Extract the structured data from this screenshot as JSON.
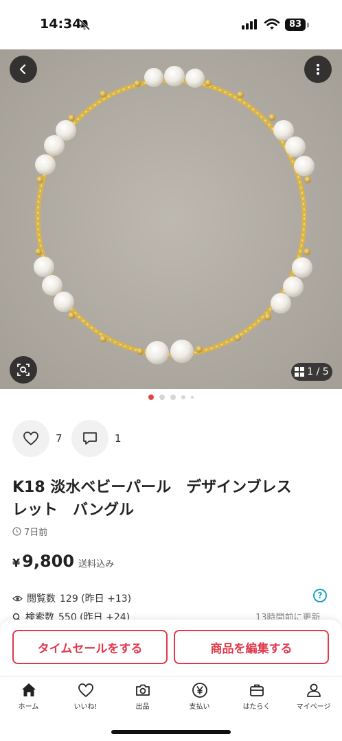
{
  "status_bar": {
    "time": "14:34",
    "battery": "83"
  },
  "gallery": {
    "counter": "1 / 5",
    "total_images": 5,
    "current_index": 1
  },
  "actions": {
    "like_count": "7",
    "comment_count": "1"
  },
  "product": {
    "title": "K18 淡水ベビーパール　デザインブレス\nレット　バングル",
    "posted": "7日前",
    "price_currency": "¥",
    "price": "9,800",
    "price_note": "送料込み"
  },
  "stats": {
    "views_label": "閲覧数",
    "views_value": "129 (昨日 +13)",
    "search_label": "検索数",
    "search_value": "550 (昨日 +24)",
    "updated": "13時間前に更新"
  },
  "sheet": {
    "timesale_label": "タイムセールをする",
    "edit_label": "商品を編集する"
  },
  "tabs": [
    {
      "label": "ホーム",
      "icon": "home-icon"
    },
    {
      "label": "いいね!",
      "icon": "heart-icon"
    },
    {
      "label": "出品",
      "icon": "camera-icon"
    },
    {
      "label": "支払い",
      "icon": "yen-icon"
    },
    {
      "label": "はたらく",
      "icon": "briefcase-icon"
    },
    {
      "label": "マイページ",
      "icon": "person-icon"
    }
  ],
  "colors": {
    "accent": "#e0394b",
    "help": "#1aa3c4",
    "active_dot": "#e94343"
  }
}
